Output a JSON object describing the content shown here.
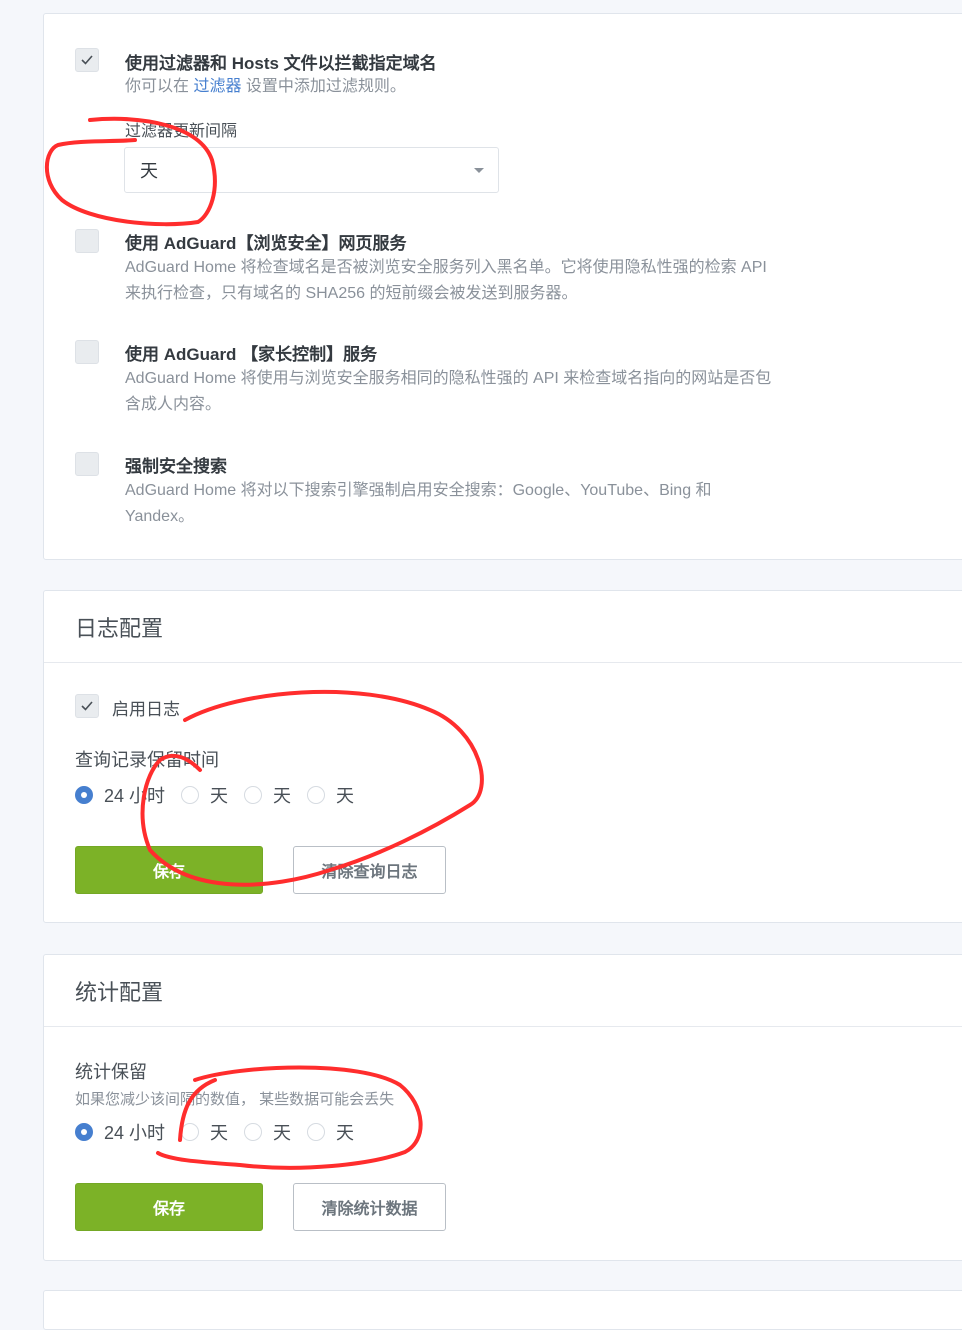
{
  "filtering": {
    "option_filters": {
      "checked": true,
      "title": "使用过滤器和 Hosts 文件以拦截指定域名",
      "desc_prefix": "你可以在 ",
      "desc_link": "过滤器",
      "desc_suffix": " 设置中添加过滤规则。"
    },
    "update_interval": {
      "label": "过滤器更新间隔",
      "value": "天"
    },
    "option_safebrowsing": {
      "checked": false,
      "title": "使用 AdGuard【浏览安全】网页服务",
      "desc": "AdGuard Home 将检查域名是否被浏览安全服务列入黑名单。它将使用隐私性强的检索 API 来执行检查，只有域名的 SHA256 的短前缀会被发送到服务器。"
    },
    "option_parental": {
      "checked": false,
      "title": "使用 AdGuard 【家长控制】服务",
      "desc": "AdGuard Home 将使用与浏览安全服务相同的隐私性强的 API 来检查域名指向的网站是否包含成人内容。"
    },
    "option_safesearch": {
      "checked": false,
      "title": "强制安全搜索",
      "desc": "AdGuard Home 将对以下搜索引擎强制启用安全搜索：Google、YouTube、Bing 和 Yandex。"
    }
  },
  "log_config": {
    "header": "日志配置",
    "enable_label": "启用日志",
    "enable_checked": true,
    "retention_label": "查询记录保留时间",
    "options": [
      {
        "label": "24 小时",
        "checked": true
      },
      {
        "label": "天",
        "checked": false
      },
      {
        "label": "天",
        "checked": false
      },
      {
        "label": "天",
        "checked": false
      }
    ],
    "save_label": "保存",
    "clear_label": "清除查询日志"
  },
  "stats_config": {
    "header": "统计配置",
    "retention_label": "统计保留",
    "note": "如果您减少该间隔的数值， 某些数据可能会丢失",
    "options": [
      {
        "label": "24 小时",
        "checked": true
      },
      {
        "label": "天",
        "checked": false
      },
      {
        "label": "天",
        "checked": false
      },
      {
        "label": "天",
        "checked": false
      }
    ],
    "save_label": "保存",
    "clear_label": "清除统计数据"
  },
  "colors": {
    "primary": "#7cb227",
    "link": "#467fcf",
    "annotation": "#ff2d2d"
  },
  "icons": {
    "check": "check-icon",
    "caret": "chevron-down-icon"
  }
}
